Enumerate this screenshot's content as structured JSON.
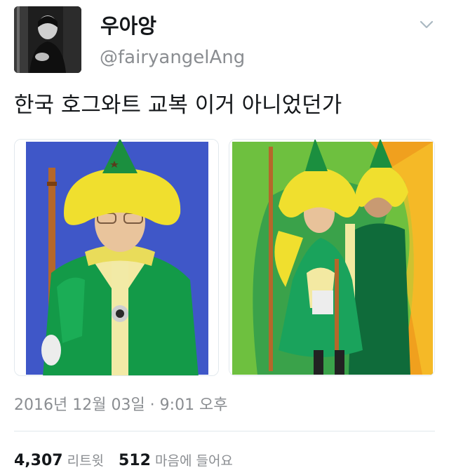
{
  "author": {
    "name": "우아앙",
    "handle": "@fairyangelAng"
  },
  "tweet": {
    "text": "한국 호그와트 교복 이거 아니었던가"
  },
  "media": [
    {
      "description_icon": "photo-child-in-green-wizard-costume"
    },
    {
      "description_icon": "photo-two-people-in-green-wizard-costumes"
    }
  ],
  "meta": {
    "timestamp": "2016년 12월 03일 · 9:01 오후"
  },
  "stats": {
    "retweets_count": "4,307",
    "retweets_label": "리트윗",
    "likes_count": "512",
    "likes_label": "마음에 들어요"
  },
  "icons": {
    "menu": "chevron-down-icon"
  },
  "colors": {
    "text": "#14171a",
    "secondary": "#8a8d91",
    "border": "#e1e8ed"
  }
}
